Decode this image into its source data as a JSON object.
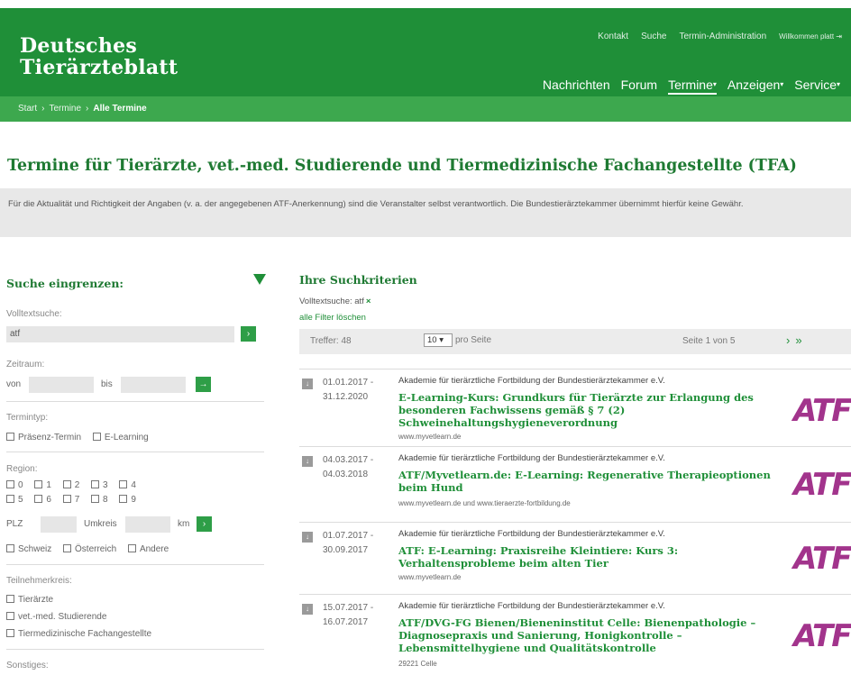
{
  "header": {
    "logo_line1": "Deutsches",
    "logo_line2": "Tierärzteblatt",
    "util_nav": [
      "Kontakt",
      "Suche",
      "Termin-Administration",
      "Willkommen platt"
    ],
    "main_nav": [
      {
        "label": "Nachrichten",
        "caret": ""
      },
      {
        "label": "Forum",
        "caret": ""
      },
      {
        "label": "Termine",
        "caret": "▾"
      },
      {
        "label": "Anzeigen",
        "caret": "▾"
      },
      {
        "label": "Service",
        "caret": "▾"
      }
    ]
  },
  "breadcrumb": [
    "Start",
    "Termine",
    "Alle Termine"
  ],
  "breadcrumb_sep": "›",
  "page_title": "Termine für Tierärzte, vet.-med. Studierende und Tiermedizinische Fachangestellte (TFA)",
  "notice": "Für die Aktualität und Richtigkeit der Angaben (v. a. der angegebenen ATF-Anerkennung) sind die Veranstalter selbst verantwortlich. Die Bundestierärztekammer übernimmt hierfür keine Gewähr.",
  "sidebar": {
    "title": "Suche eingrenzen:",
    "fulltext_label": "Volltextsuche:",
    "fulltext_value": "atf",
    "go_symbol": "›",
    "period_label": "Zeitraum:",
    "from_label": "von",
    "to_label": "bis",
    "period_go": "→",
    "type_label": "Termintyp:",
    "types": [
      "Präsenz-Termin",
      "E-Learning"
    ],
    "region_label": "Region:",
    "regions_row1": [
      "0",
      "1",
      "2",
      "3",
      "4"
    ],
    "regions_row2": [
      "5",
      "6",
      "7",
      "8",
      "9"
    ],
    "plz_label": "PLZ",
    "radius_label": "Umkreis",
    "radius_unit": "km",
    "countries": [
      "Schweiz",
      "Österreich",
      "Andere"
    ],
    "audience_label": "Teilnehmerkreis:",
    "audience": [
      "Tierärzte",
      "vet.-med. Studierende",
      "Tiermedizinische Fachangestellte"
    ],
    "other_label": "Sonstiges:"
  },
  "results": {
    "title": "Ihre Suchkriterien",
    "criteria": "Volltextsuche: atf",
    "criteria_remove": "×",
    "reset": "alle Filter löschen",
    "hits": "Treffer: 48",
    "per_page_value": "10",
    "per_page_label": "pro Seite",
    "page_info": "Seite 1 von 5",
    "next": "›",
    "last": "»"
  },
  "events": [
    {
      "date_from": "01.01.2017 -",
      "date_to": "31.12.2020",
      "organizer": "Akademie für tierärztliche Fortbildung der Bundestierärztekammer e.V.",
      "title": "E-Learning-Kurs: Grundkurs für Tierärzte zur Erlangung des besonderen Fachwissens gemäß § 7 (2) Schweinehaltungshygieneverordnung",
      "url": "www.myvetlearn.de",
      "logo": "ATF"
    },
    {
      "date_from": "04.03.2017 -",
      "date_to": "04.03.2018",
      "organizer": "Akademie für tierärztliche Fortbildung der Bundestierärztekammer e.V.",
      "title": "ATF/Myvetlearn.de: E-Learning: Regenerative Therapieoptionen beim Hund",
      "url": "www.myvetlearn.de und www.tieraerzte-fortbildung.de",
      "logo": "ATF"
    },
    {
      "date_from": "01.07.2017 -",
      "date_to": "30.09.2017",
      "organizer": "Akademie für tierärztliche Fortbildung der Bundestierärztekammer e.V.",
      "title": "ATF: E-Learning: Praxisreihe Kleintiere: Kurs 3: Verhaltensprobleme beim alten Tier",
      "url": "www.myvetlearn.de",
      "logo": "ATF"
    },
    {
      "date_from": "15.07.2017 -",
      "date_to": "16.07.2017",
      "organizer": "Akademie für tierärztliche Fortbildung der Bundestierärztekammer e.V.",
      "title": "ATF/DVG-FG Bienen/Bieneninstitut Celle: Bienenpathologie – Diagnosepraxis und Sanierung, Honigkontrolle – Lebensmittelhygiene und Qualitätskontrolle",
      "url": "29221 Celle",
      "logo": "ATF"
    }
  ],
  "colors": {
    "brand_green": "#1f8f38",
    "breadcrumb_green": "#3da84e",
    "title_green": "#1f7a33",
    "atf_purple": "#a2348c"
  }
}
